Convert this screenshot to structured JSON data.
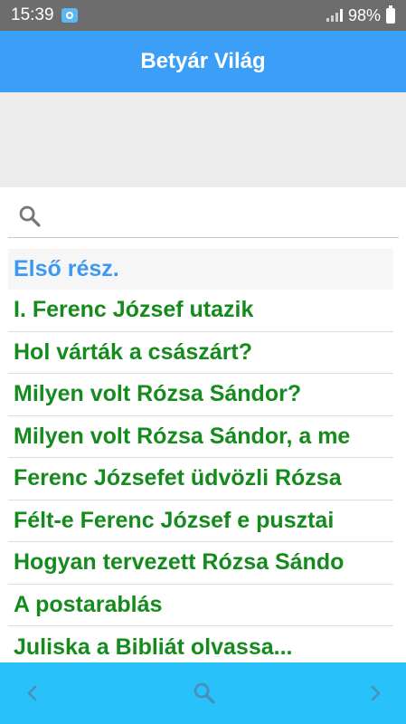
{
  "status_bar": {
    "time": "15:39",
    "battery_text": "98%",
    "notification_icon": "screenshot-icon",
    "signal_icon": "signal-icon",
    "battery_icon": "battery-icon"
  },
  "app_bar": {
    "title": "Betyár Világ"
  },
  "search": {
    "icon": "search-icon",
    "value": ""
  },
  "list": {
    "section_title": "Első rész.",
    "items": [
      "I. Ferenc József utazik",
      "Hol várták a császárt?",
      "Milyen volt Rózsa Sándor?",
      "Milyen volt Rózsa Sándor, a me",
      "Ferenc Józsefet üdvözli Rózsa",
      "Félt-e Ferenc József e pusztai",
      "Hogyan tervezett Rózsa Sándo",
      "A postarablás",
      "Juliska a Bibliát olvassa..."
    ]
  },
  "bottom_bar": {
    "back_icon": "chevron-left-icon",
    "search_icon": "search-icon",
    "forward_icon": "chevron-right-icon"
  },
  "colors": {
    "app_bar": "#3c9ff7",
    "bottom_bar": "#29c1f9",
    "section_title": "#3d98f1",
    "list_item_text": "#158a1d",
    "status_bar": "#6d6d6d"
  }
}
